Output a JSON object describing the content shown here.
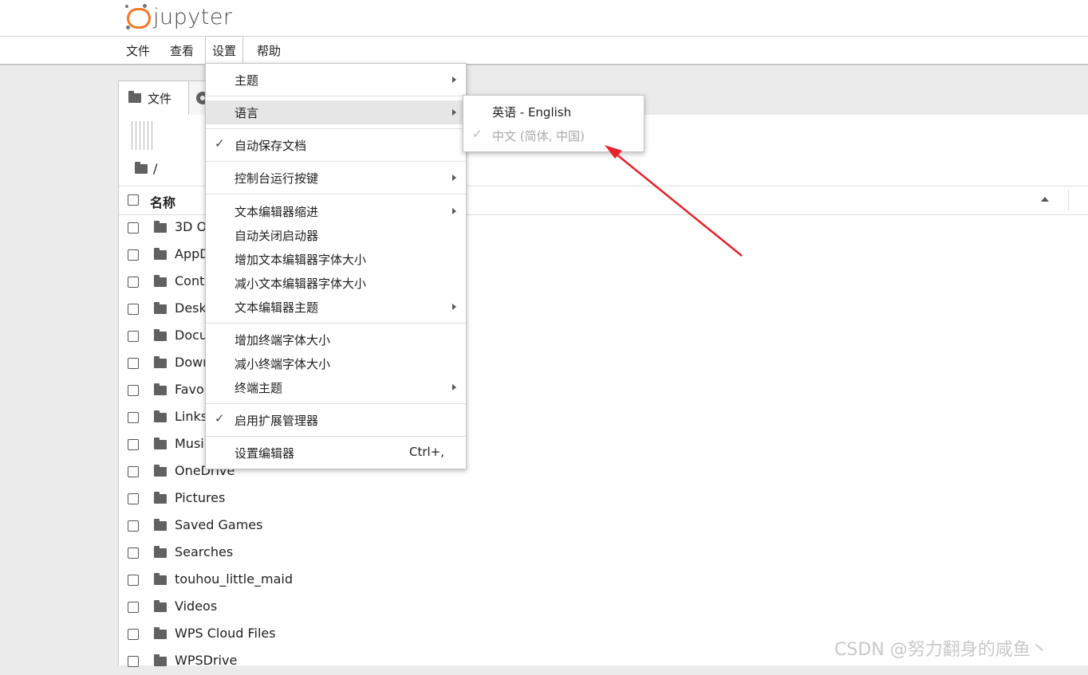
{
  "app": {
    "logo_text": "jupyter"
  },
  "menubar": [
    {
      "label": "文件"
    },
    {
      "label": "查看"
    },
    {
      "label": "设置"
    },
    {
      "label": "帮助"
    }
  ],
  "tabs": {
    "files_label": "文件"
  },
  "breadcrumb": {
    "path": "/"
  },
  "file_header": {
    "name_label": "名称"
  },
  "files": [
    "3D O",
    "AppD",
    "Cont",
    "Desk",
    "Docu",
    "Dowr",
    "Favor",
    "Links",
    "Musi",
    "OneDrive",
    "Pictures",
    "Saved Games",
    "Searches",
    "touhou_little_maid",
    "Videos",
    "WPS Cloud Files",
    "WPSDrive"
  ],
  "settings_menu": {
    "items": [
      {
        "label": "主题",
        "submenu": true
      },
      {
        "label": "语言",
        "submenu": true,
        "highlighted": true
      },
      {
        "label": "自动保存文档",
        "checked": true
      },
      {
        "label": "控制台运行按键",
        "submenu": true
      },
      {
        "label": "文本编辑器缩进",
        "submenu": true
      },
      {
        "label": "自动关闭启动器"
      },
      {
        "label": "增加文本编辑器字体大小"
      },
      {
        "label": "减小文本编辑器字体大小"
      },
      {
        "label": "文本编辑器主题",
        "submenu": true
      },
      {
        "label": "增加终端字体大小"
      },
      {
        "label": "减小终端字体大小"
      },
      {
        "label": "终端主题",
        "submenu": true
      },
      {
        "label": "启用扩展管理器",
        "checked": true
      },
      {
        "label": "设置编辑器",
        "shortcut": "Ctrl+,"
      }
    ]
  },
  "language_submenu": {
    "items": [
      {
        "label": "英语 - English"
      },
      {
        "label": "中文 (简体, 中国)",
        "checked": true,
        "disabled": true
      }
    ]
  },
  "annotation": {
    "arrow_color": "#e8212b"
  },
  "watermark": "CSDN @努力翻身的咸鱼丶",
  "colors": {
    "accent": "#f37726",
    "highlight": "#e6e6e6"
  }
}
